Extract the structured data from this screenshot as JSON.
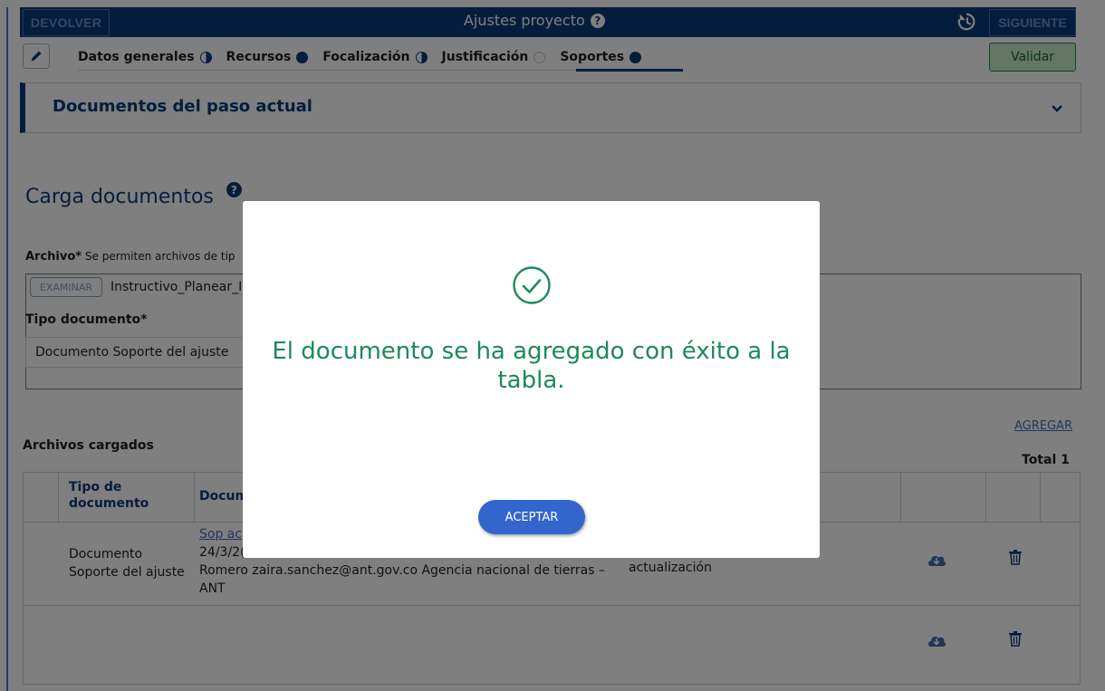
{
  "header": {
    "devolver_label": "DEVOLVER",
    "title": "Ajustes proyecto",
    "help_glyph": "?",
    "siguiente_label": "SIGUIENTE",
    "history_icon": "history-icon"
  },
  "tabs": [
    {
      "label": "Datos generales",
      "status": "half"
    },
    {
      "label": "Recursos",
      "status": "full"
    },
    {
      "label": "Focalización",
      "status": "half"
    },
    {
      "label": "Justificación",
      "status": "empty"
    },
    {
      "label": "Soportes",
      "status": "full",
      "active": true
    }
  ],
  "validar_label": "Validar",
  "documentos_panel": {
    "title": "Documentos del paso actual"
  },
  "carga": {
    "title": "Carga documentos",
    "archivo_label": "Archivo*",
    "archivo_hint": "Se permiten archivos de tip",
    "examinar_label": "EXAMINAR",
    "file_name": "Instructivo_Planear_I",
    "tipo_label": "Tipo documento*",
    "tipo_value": "Documento Soporte del ajuste"
  },
  "agregar_label": "AGREGAR",
  "archivos_label": "Archivos cargados",
  "total_label": "Total  1",
  "table": {
    "headers": {
      "tipo_line1": "Tipo de",
      "tipo_line2": "documento",
      "documento": "Docum"
    },
    "rows": [
      {
        "tipo_line1": "Documento",
        "tipo_line2": "Soporte del ajuste",
        "doc_link": "Sop ac",
        "doc_line2": "24/3/2(",
        "doc_line3": "Romero zaira.sanchez@ant.gov.co Agencia nacional de tierras –",
        "doc_line4": "ANT",
        "observacion": "actualización"
      }
    ]
  },
  "modal": {
    "message": "El documento se ha agregado con éxito a la tabla.",
    "accept_label": "ACEPTAR",
    "icon": "check-circle-icon"
  },
  "colors": {
    "primary": "#0b3a78",
    "success": "#1c8a5a",
    "accept_button": "#3366cc",
    "validar_bg": "#c8eccb"
  }
}
